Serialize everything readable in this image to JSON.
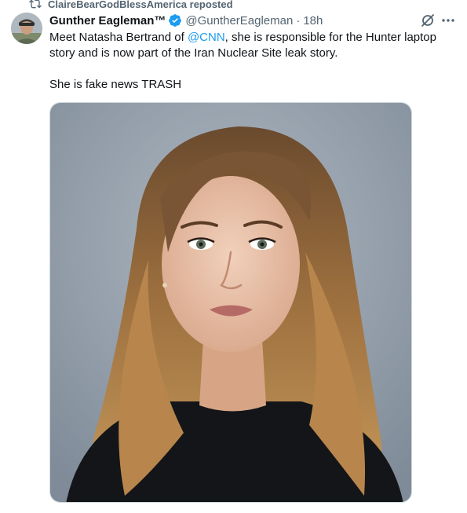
{
  "repost": {
    "icon": "repost-icon",
    "label": "ClaireBearGodBlessAmerica reposted"
  },
  "author": {
    "display_name": "Gunther Eagleman™",
    "verified_icon": "verified-badge-icon",
    "handle": "@GuntherEagleman",
    "separator": "·",
    "time": "18h"
  },
  "actions": {
    "grok_icon": "grok-icon",
    "more_icon": "more-options-icon"
  },
  "tweet": {
    "text_before_mention": "Meet Natasha Bertrand of ",
    "mention": "@CNN",
    "text_after_mention": ", she is responsible for the Hunter laptop story and is now part of the Iran Nuclear Site leak story.",
    "second_paragraph": "She is fake news TRASH"
  },
  "colors": {
    "link": "#1d9bf0",
    "secondary_text": "#536471",
    "primary_text": "#0f1419",
    "photo_background": "#8d99a6"
  }
}
